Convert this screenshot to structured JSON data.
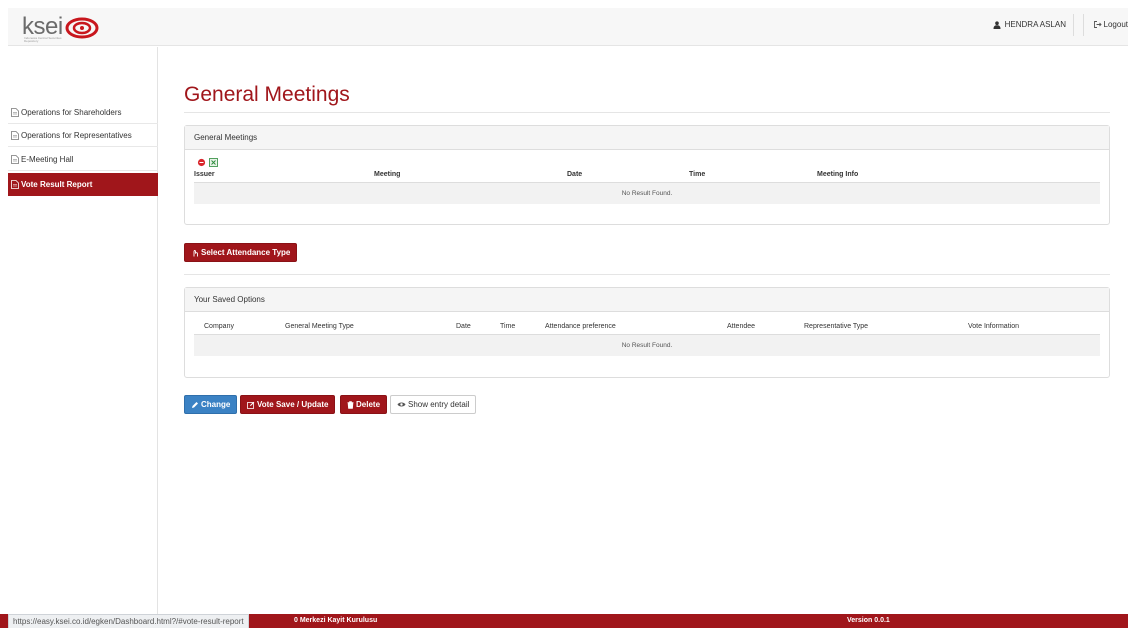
{
  "brand": {
    "logo_text": "ksei",
    "logo_subtitle": "Indonesia Central Securities Depository",
    "accent_color": "#a0161b"
  },
  "header": {
    "user_name": "HENDRA ASLAN",
    "logout_label": "Logout",
    "user_icon": "person-icon",
    "logout_icon": "sign-out-icon"
  },
  "sidebar": {
    "items": [
      {
        "label": "Operations for Shareholders",
        "icon": "file-icon",
        "active": false
      },
      {
        "label": "Operations for Representatives",
        "icon": "file-icon",
        "active": false
      },
      {
        "label": "E-Meeting Hall",
        "icon": "file-icon",
        "active": false
      },
      {
        "label": "Vote Result Report",
        "icon": "file-icon",
        "active": true
      }
    ]
  },
  "main": {
    "title": "General Meetings",
    "meetings_panel": {
      "heading": "General Meetings",
      "columns": [
        "Issuer",
        "Meeting",
        "Date",
        "Time",
        "Meeting Info"
      ],
      "empty_text": "No Result Found.",
      "export_icons": [
        "pdf-export-icon",
        "excel-export-icon"
      ]
    },
    "attendance_button": "Select Attendance Type",
    "saved_panel": {
      "heading": "Your Saved Options",
      "columns": [
        "Company",
        "General Meeting Type",
        "Date",
        "Time",
        "Attendance preference",
        "Attendee",
        "Representative Type",
        "Vote Information"
      ],
      "empty_text": "No Result Found."
    },
    "actions": {
      "change": "Change",
      "vote_save": "Vote Save / Update",
      "delete": "Delete",
      "show_detail": "Show entry detail"
    }
  },
  "footer": {
    "text": "0 Merkezi Kayit Kurulusu",
    "version": "Version 0.0.1"
  },
  "status_bar": {
    "url": "https://easy.ksei.co.id/egken/Dashboard.html?/#vote-result-report"
  }
}
